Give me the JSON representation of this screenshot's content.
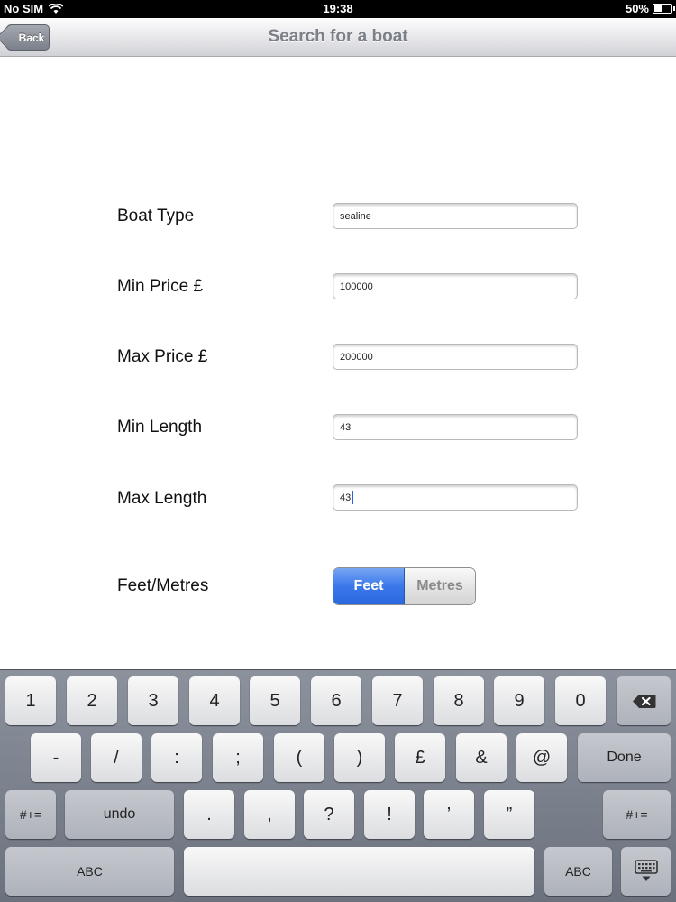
{
  "status_bar": {
    "carrier": "No SIM",
    "time": "19:38",
    "battery": "50%",
    "battery_level": 0.5
  },
  "nav": {
    "title": "Search for a boat",
    "back_label": "Back"
  },
  "form": {
    "boat_type": {
      "label": "Boat Type",
      "value": "sealine"
    },
    "min_price": {
      "label": "Min Price £",
      "value": "100000"
    },
    "max_price": {
      "label": "Max Price £",
      "value": "200000"
    },
    "min_length": {
      "label": "Min Length",
      "value": "43"
    },
    "max_length": {
      "label": "Max Length",
      "value": "43"
    },
    "units": {
      "label": "Feet/Metres",
      "options": [
        "Feet",
        "Metres"
      ],
      "selected": "Feet"
    }
  },
  "keyboard": {
    "row1": [
      "1",
      "2",
      "3",
      "4",
      "5",
      "6",
      "7",
      "8",
      "9",
      "0"
    ],
    "row2": [
      "-",
      "/",
      ":",
      ";",
      "(",
      ")",
      "£",
      "&",
      "@"
    ],
    "done": "Done",
    "row3_left": "#+=",
    "undo": "undo",
    "row3": [
      ".",
      ",",
      "?",
      "!",
      "’",
      "”"
    ],
    "row3_right": "#+=",
    "abc_left": "ABC",
    "abc_right": "ABC",
    "icons": {
      "delete": "delete-icon",
      "dismiss": "keyboard-dismiss-icon"
    }
  },
  "colors": {
    "segment_active": "#3a78ea",
    "cursor": "#2a5fe0"
  }
}
